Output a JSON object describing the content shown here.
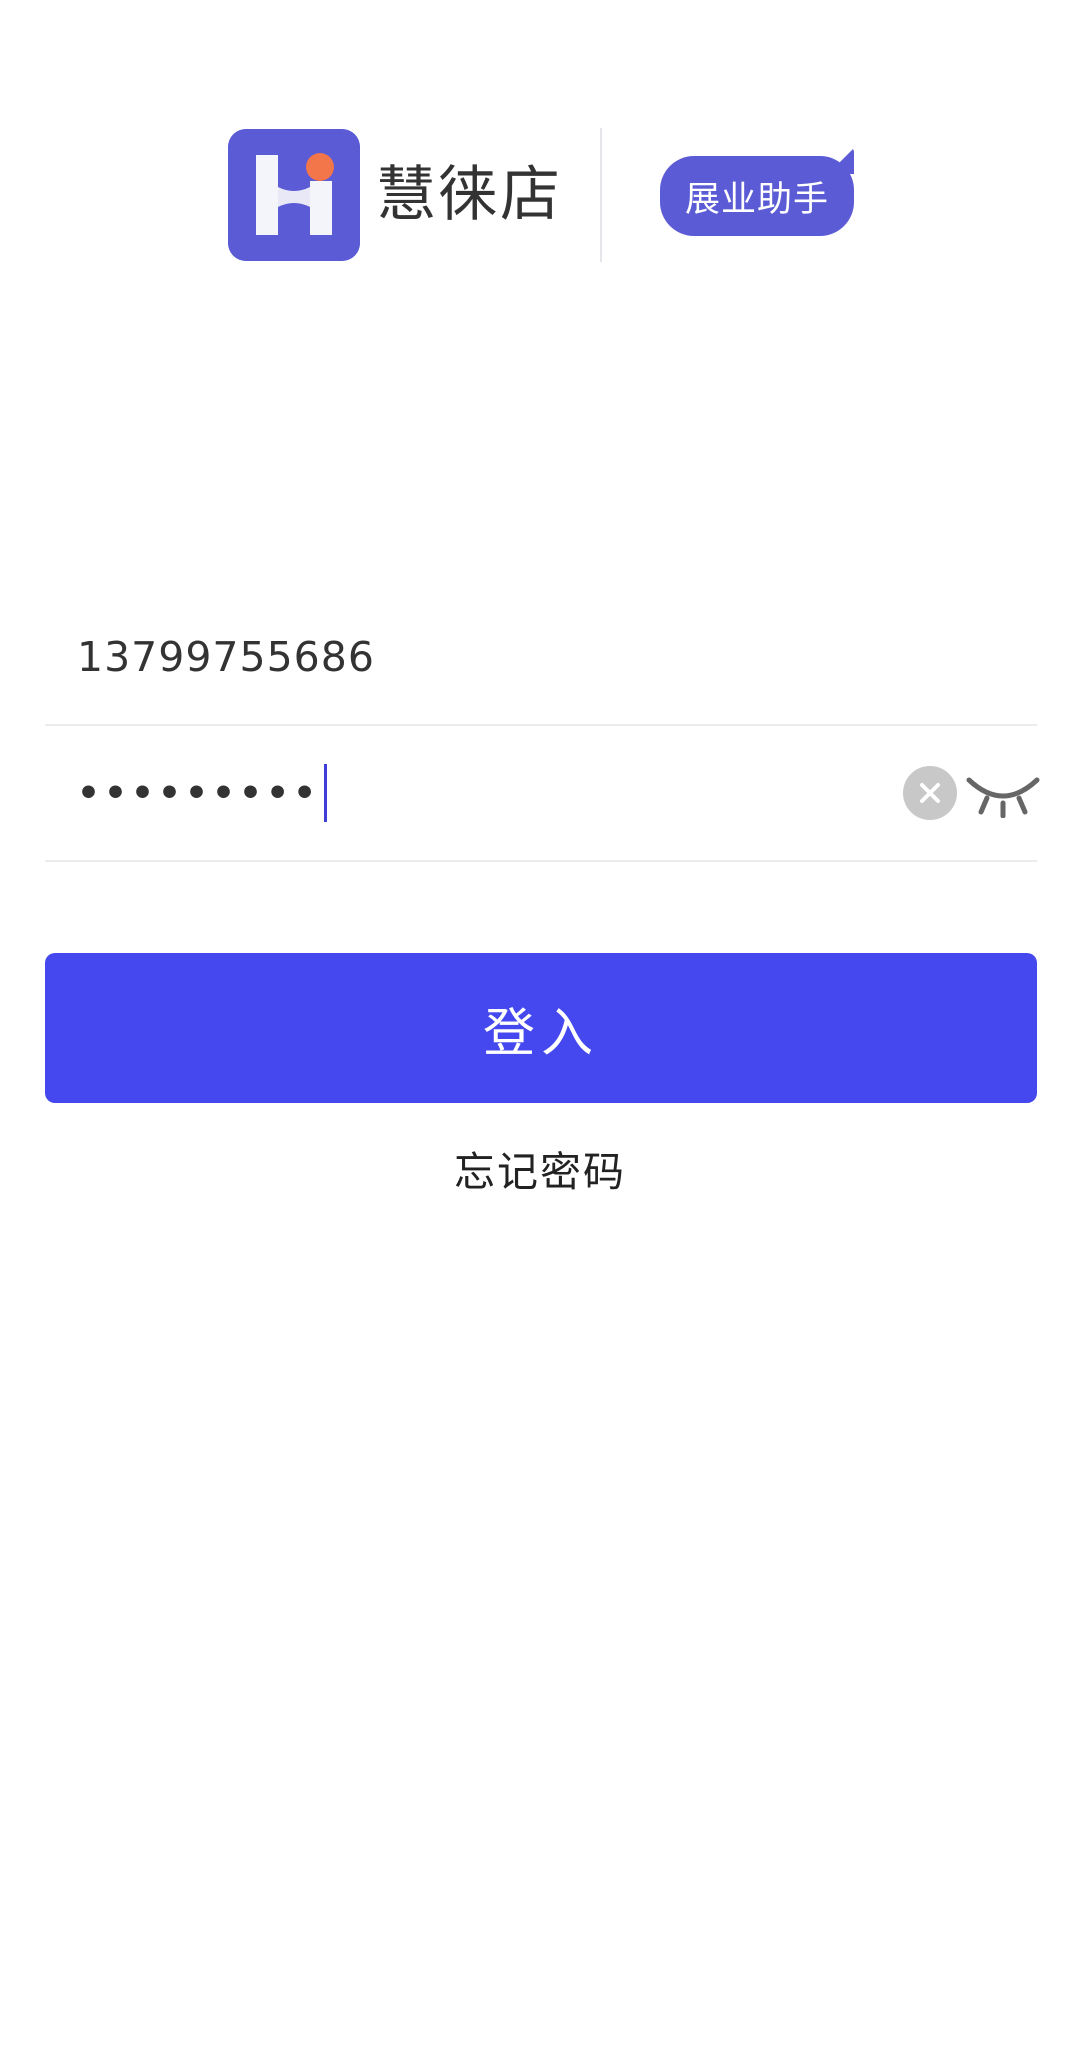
{
  "header": {
    "brand_name": "慧徕店",
    "tag_label": "展业助手",
    "logo_icon": "hui-logo-icon",
    "accent_color": "#5b5bd6",
    "logo_dot_color": "#f2764a"
  },
  "form": {
    "username_value": "13799755686",
    "password_mask": "•••••••••",
    "clear_icon": "clear-icon",
    "visibility_icon": "eye-closed-icon"
  },
  "actions": {
    "login_label": "登入",
    "login_color": "#4448ee",
    "forgot_label": "忘记密码"
  }
}
